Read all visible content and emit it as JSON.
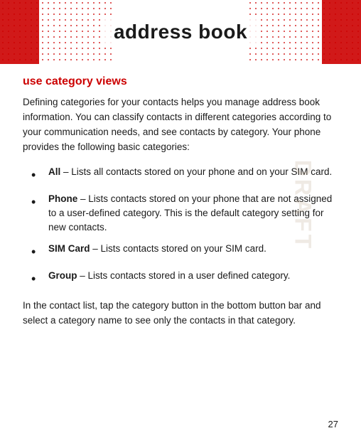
{
  "header": {
    "title": "address book"
  },
  "section": {
    "title": "use category views",
    "intro": "Defining categories for your contacts helps you manage address book information. You can classify contacts in different categories according to your communication needs, and see contacts by category. Your phone provides the following basic categories:",
    "bullets": [
      {
        "term": "All",
        "definition": "– Lists all contacts stored on your phone and on your SIM card."
      },
      {
        "term": "Phone",
        "definition": "– Lists contacts stored on your phone that are not assigned to a user-defined category. This is the default category setting for new contacts."
      },
      {
        "term": "SIM Card",
        "definition": "– Lists contacts stored on your SIM card."
      },
      {
        "term": "Group",
        "definition": "– Lists contacts stored in a user defined category."
      }
    ],
    "footer": "In the contact list, tap the category button in the bottom button bar and select a category name to see only the contacts in that category."
  },
  "page_number": "27",
  "watermark": "DRAFT"
}
